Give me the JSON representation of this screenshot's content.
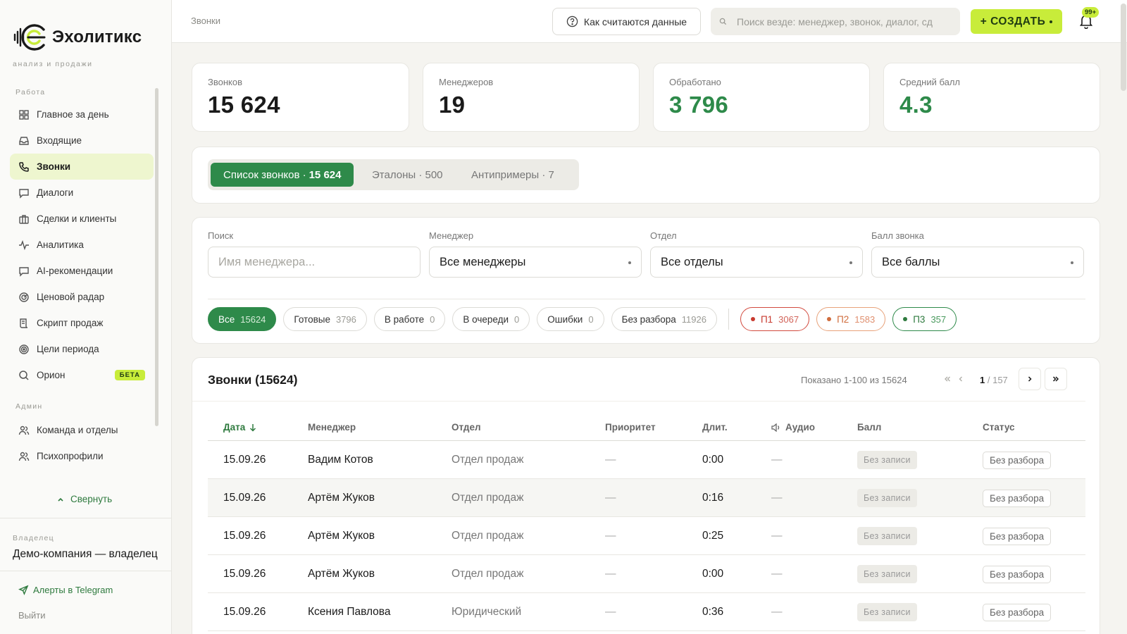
{
  "brand": {
    "name": "Эхолитикс",
    "tagline": "анализ и продажи"
  },
  "sidebar": {
    "section_work": "Работа",
    "section_admin": "Админ",
    "items": [
      {
        "label": "Главное за день",
        "icon": "dashboard-icon"
      },
      {
        "label": "Входящие",
        "icon": "inbox-icon"
      },
      {
        "label": "Звонки",
        "icon": "phone-icon",
        "active": true
      },
      {
        "label": "Диалоги",
        "icon": "chat-icon"
      },
      {
        "label": "Сделки и клиенты",
        "icon": "briefcase-icon"
      },
      {
        "label": "Аналитика",
        "icon": "pulse-icon"
      },
      {
        "label": "AI-рекомендации",
        "icon": "chat-icon"
      },
      {
        "label": "Ценовой радар",
        "icon": "radar-icon"
      },
      {
        "label": "Скрипт продаж",
        "icon": "script-icon"
      },
      {
        "label": "Цели периода",
        "icon": "target-icon"
      },
      {
        "label": "Орион",
        "icon": "search-icon",
        "badge": "БЕТА"
      }
    ],
    "admin_items": [
      {
        "label": "Команда и отделы",
        "icon": "team-icon"
      },
      {
        "label": "Психопрофили",
        "icon": "users-icon"
      }
    ],
    "collapse_label": "Свернуть",
    "owner_label": "Владелец",
    "owner_name": "Демо-компания — владелец",
    "telegram_label": "Алерты в Telegram",
    "logout_label": "Выйти"
  },
  "topbar": {
    "breadcrumb": "Звонки",
    "how_label": "Как считаются данные",
    "search_placeholder": "Поиск везде: менеджер, звонок, диалог, сд",
    "create_label": "+ СОЗДАТЬ",
    "notifications_badge": "99+"
  },
  "stats": [
    {
      "label": "Звонков",
      "value": "15 624",
      "green": false
    },
    {
      "label": "Менеджеров",
      "value": "19",
      "green": false
    },
    {
      "label": "Обработано",
      "value": "3 796",
      "green": true
    },
    {
      "label": "Средний балл",
      "value": "4.3",
      "green": true
    }
  ],
  "tabs": {
    "list_label": "Список звонков ·",
    "list_count": "15 624",
    "etalons": "Эталоны · 500",
    "antiexamples": "Антипримеры · 7"
  },
  "filters": {
    "search_label": "Поиск",
    "search_placeholder": "Имя менеджера...",
    "manager_label": "Менеджер",
    "manager_value": "Все менеджеры",
    "dept_label": "Отдел",
    "dept_value": "Все отделы",
    "score_label": "Балл звонка",
    "score_value": "Все баллы"
  },
  "chips": [
    {
      "label": "Все",
      "count": "15624"
    },
    {
      "label": "Готовые",
      "count": "3796"
    },
    {
      "label": "В работе",
      "count": "0"
    },
    {
      "label": "В очереди",
      "count": "0"
    },
    {
      "label": "Ошибки",
      "count": "0"
    },
    {
      "label": "Без разбора",
      "count": "11926"
    }
  ],
  "priority_chips": [
    {
      "label": "П1",
      "count": "3067",
      "color": "#d24a3e"
    },
    {
      "label": "П2",
      "count": "1583",
      "color": "#e8a27a"
    },
    {
      "label": "П3",
      "count": "357",
      "color": "#2e8a4a"
    }
  ],
  "table": {
    "title": "Звонки (15624)",
    "shown": "Показано 1-100 из 15624",
    "page_current": "1",
    "page_total": "/ 157",
    "columns": [
      "Дата",
      "Менеджер",
      "Отдел",
      "Приоритет",
      "Длит.",
      "Аудио",
      "Балл",
      "Статус"
    ],
    "rows": [
      {
        "date": "15.09.26",
        "manager": "Вадим Котов",
        "dept": "Отдел продаж",
        "priority": "—",
        "duration": "0:00",
        "audio": "—",
        "score": "Без записи",
        "status": "Без разбора"
      },
      {
        "date": "15.09.26",
        "manager": "Артём Жуков",
        "dept": "Отдел продаж",
        "priority": "—",
        "duration": "0:16",
        "audio": "—",
        "score": "Без записи",
        "status": "Без разбора"
      },
      {
        "date": "15.09.26",
        "manager": "Артём Жуков",
        "dept": "Отдел продаж",
        "priority": "—",
        "duration": "0:25",
        "audio": "—",
        "score": "Без записи",
        "status": "Без разбора"
      },
      {
        "date": "15.09.26",
        "manager": "Артём Жуков",
        "dept": "Отдел продаж",
        "priority": "—",
        "duration": "0:00",
        "audio": "—",
        "score": "Без записи",
        "status": "Без разбора"
      },
      {
        "date": "15.09.26",
        "manager": "Ксения Павлова",
        "dept": "Юридический",
        "priority": "—",
        "duration": "0:36",
        "audio": "—",
        "score": "Без записи",
        "status": "Без разбора"
      }
    ]
  },
  "colors": {
    "accent": "#c8ec3a",
    "primary_green": "#2e8a4a",
    "active_nav_bg": "#eef6cf"
  }
}
